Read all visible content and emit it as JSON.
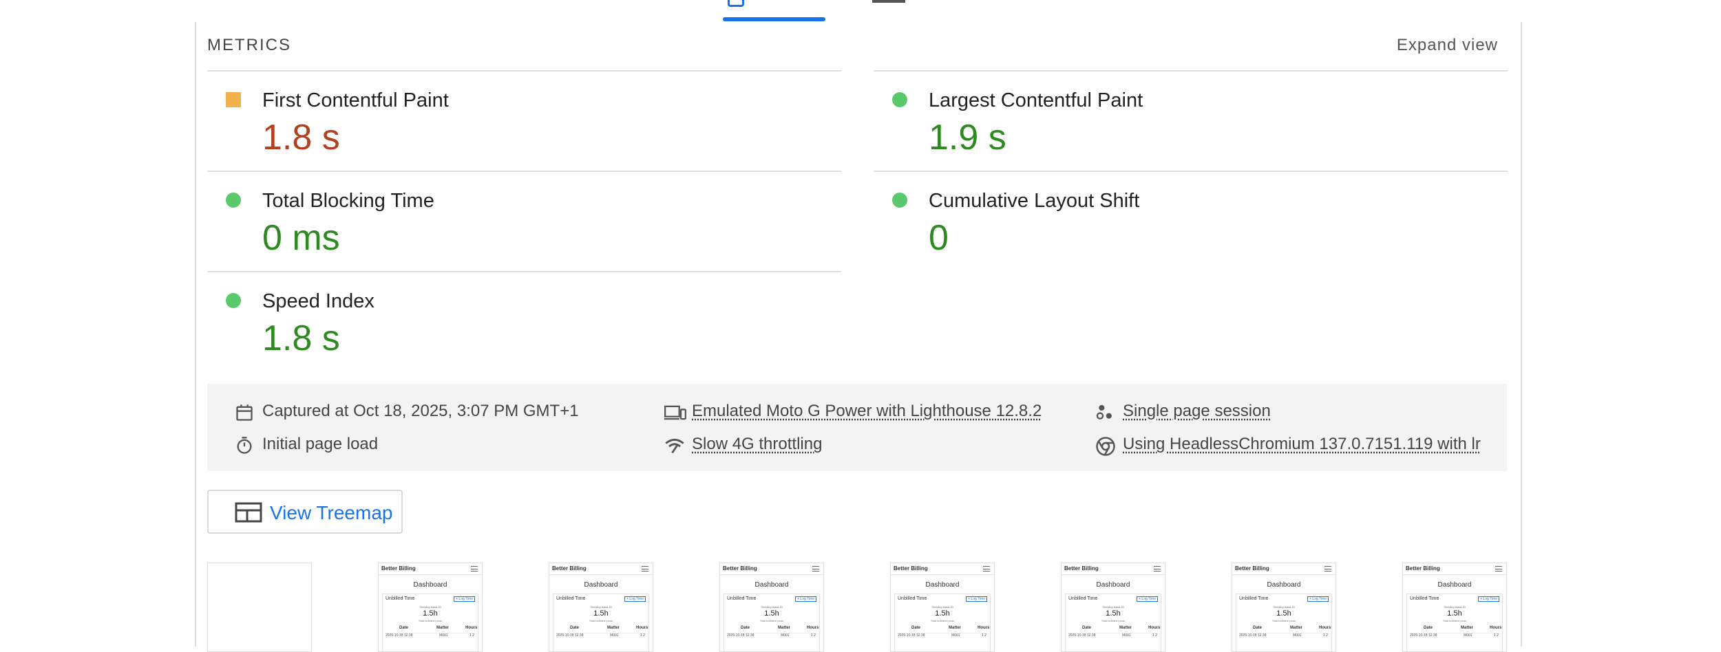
{
  "metrics": {
    "heading": "METRICS",
    "expand_label": "Expand view",
    "items": [
      {
        "title": "First Contentful Paint",
        "value": "1.8 s",
        "rating": "average",
        "shape": "square",
        "color": "#b2401f"
      },
      {
        "title": "Largest Contentful Paint",
        "value": "1.9 s",
        "rating": "pass",
        "shape": "circle",
        "color": "#2d8a1f"
      },
      {
        "title": "Total Blocking Time",
        "value": "0 ms",
        "rating": "pass",
        "shape": "circle",
        "color": "#2d8a1f"
      },
      {
        "title": "Cumulative Layout Shift",
        "value": "0",
        "rating": "pass",
        "shape": "circle",
        "color": "#2d8a1f"
      },
      {
        "title": "Speed Index",
        "value": "1.8 s",
        "rating": "pass",
        "shape": "circle",
        "color": "#2d8a1f"
      }
    ]
  },
  "run_info": {
    "captured": {
      "icon": "calendar-icon",
      "text": "Captured at Oct 18, 2025, 3:07 PM GMT+1"
    },
    "load": {
      "icon": "stopwatch-icon",
      "text": "Initial page load"
    },
    "device": {
      "icon": "devices-icon",
      "text": "Emulated Moto G Power with Lighthouse 12.8.2"
    },
    "throttling": {
      "icon": "network-icon",
      "text": "Slow 4G throttling"
    },
    "session": {
      "icon": "session-icon",
      "text": "Single page session"
    },
    "browser": {
      "icon": "chrome-icon",
      "text": "Using HeadlessChromium 137.0.7151.119 with lr"
    }
  },
  "treemap_button": {
    "icon": "treemap-icon",
    "label": "View Treemap"
  },
  "filmstrip": {
    "thumbnail": {
      "brand": "Better Billing",
      "heading": "Dashboard",
      "card_title": "Unbilled Time",
      "button": "+ Log Time",
      "subtitle": "Showing latest 10",
      "big_value": "1.5h",
      "caption": "Total unbilled hours",
      "columns": [
        "Date",
        "Matter",
        "Hours"
      ],
      "row": [
        "2025-10-18 12:38",
        "M001",
        "1.2"
      ]
    }
  },
  "colors": {
    "accent": "#1a73e8",
    "pass": "#2d8a1f",
    "average": "#b2401f",
    "pass_indicator": "#5ac96b",
    "average_indicator": "#f5b04e"
  }
}
